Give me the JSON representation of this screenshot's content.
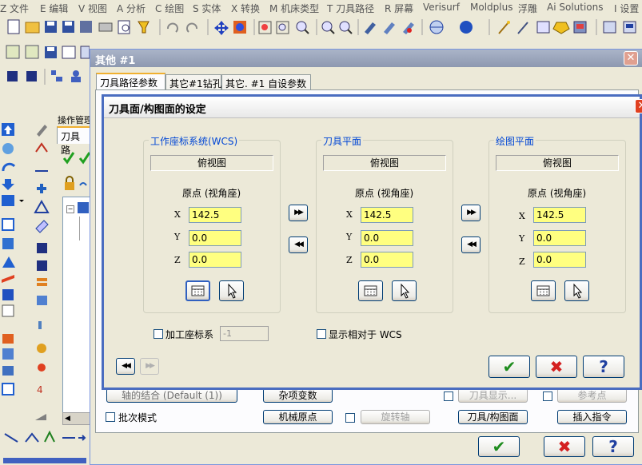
{
  "menubar": [
    "Z 文件",
    "E 编辑",
    "V 视图",
    "A 分析",
    "C 绘图",
    "S 实体",
    "X 转换",
    "M 机床类型",
    "T 刀具路径",
    "R 屏幕",
    "Verisurf",
    "Moldplus",
    "浮雕",
    "Ai Solutions",
    "I 设置"
  ],
  "ops_panel": {
    "title": "操作管理",
    "tab": "刀具路"
  },
  "main_dialog": {
    "title": "其他 #1",
    "close": "✕",
    "tabs": [
      "刀具路径参数",
      "其它#1钻孔",
      "其它. #1 自设参数"
    ],
    "btn_axis_combo": "轴的结合 (Default (1))",
    "btn_misc_vars": "杂项变数",
    "btn_tool_display": "刀具显示...",
    "btn_ref_point": "参考点",
    "batch_mode": "批次模式",
    "btn_machine_origin": "机械原点",
    "btn_rotary_axis": "旋转轴",
    "btn_tool_plane": "刀具/构图面",
    "btn_insert_cmd": "插入指令"
  },
  "inner_dialog": {
    "title": "刀具面/构图面的设定",
    "groups": [
      {
        "title": "工作座标系统(WCS)",
        "view": "俯视图",
        "origin_label": "原点 (视角座)",
        "x": "142.5",
        "y": "0.0",
        "z": "0.0"
      },
      {
        "title": "刀具平面",
        "view": "俯视图",
        "origin_label": "原点 (视角座)",
        "x": "142.5",
        "y": "0.0",
        "z": "0.0"
      },
      {
        "title": "绘图平面",
        "view": "俯视图",
        "origin_label": "原点 (视角座)",
        "x": "142.5",
        "y": "0.0",
        "z": "0.0"
      }
    ],
    "axis_labels": {
      "x": "X",
      "y": "Y",
      "z": "Z"
    },
    "work_offset_label": "加工座标系",
    "work_offset_value": "-1",
    "show_relative_label": "显示相对于 WCS",
    "copy_right": "▶▶",
    "copy_left": "◀◀",
    "nav_prev": "◀◀",
    "nav_next": "▶▶"
  },
  "colors": {
    "accent": "#4a6dc0",
    "field": "#ffff80",
    "ok": "#1e8c1e",
    "cancel": "#d42020"
  }
}
